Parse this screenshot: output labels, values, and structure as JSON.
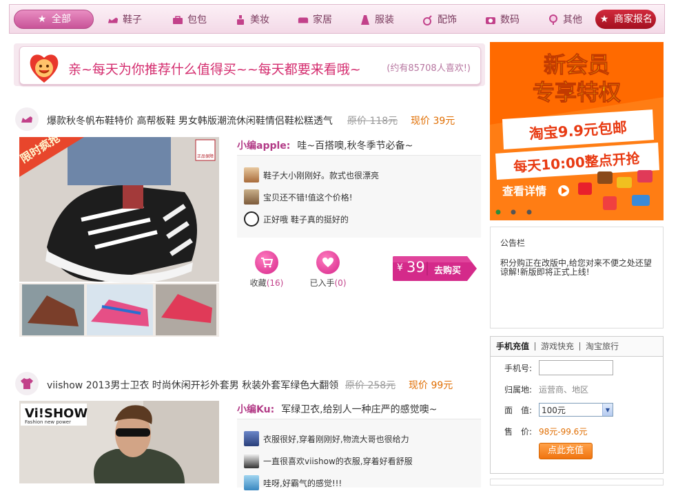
{
  "nav": {
    "items": [
      {
        "label": "全部",
        "icon": "star-icon"
      },
      {
        "label": "鞋子",
        "icon": "shoe-icon"
      },
      {
        "label": "包包",
        "icon": "bag-icon"
      },
      {
        "label": "美妆",
        "icon": "cosmetics-icon"
      },
      {
        "label": "家居",
        "icon": "home-icon"
      },
      {
        "label": "服装",
        "icon": "dress-icon"
      },
      {
        "label": "配饰",
        "icon": "ring-icon"
      },
      {
        "label": "数码",
        "icon": "camera-icon"
      },
      {
        "label": "其他",
        "icon": "lollipop-icon"
      },
      {
        "label": "商家报名",
        "icon": "star-icon"
      }
    ],
    "colors": {
      "accent": "#c85398",
      "merchant": "#b8182a"
    }
  },
  "banner": {
    "text": "亲~每天为你推荐什么值得买~~每天都要来看哦~",
    "count": "(约有85708人喜欢!)"
  },
  "items": [
    {
      "title": "爆款秋冬帆布鞋特价 高帮板鞋 男女韩版潮流休闲鞋情侣鞋松糕透气",
      "original_price": "原价 118元",
      "current_price": "现价 39元",
      "photo_badge": "限时疯抢",
      "photo_seal": "正品保障",
      "editor_name": "小编apple:",
      "editor_msg": "哇~百搭噢,秋冬季节必备~",
      "comments": [
        "鞋子大小刚刚好。款式也很漂亮",
        "宝贝还不错!值这个价格!",
        "正好哦 鞋子真的挺好的"
      ],
      "collect_label": "收藏",
      "collect_count": "(16)",
      "bought_label": "已入手",
      "bought_count": "(0)",
      "buy_price": "39",
      "buy_currency": "¥",
      "buy_label": "去购买"
    },
    {
      "title": "viishow 2013男士卫衣 时尚休闲开衫外套男 秋装外套军绿色大翻领",
      "original_price": "原价 258元",
      "current_price": "现价 99元",
      "photo_brand": "Vi!SHOW",
      "photo_tagline": "Fashion new power",
      "editor_name": "小编Ku:",
      "editor_msg": "军绿卫衣,给别人一种庄严的感觉噢~",
      "comments": [
        "衣服很好,穿着刚刚好,物流大哥也很给力",
        "一直很喜欢viishow的衣服,穿着好看舒服",
        "哇呀,好霸气的感觉!!!"
      ]
    }
  ],
  "sidebar": {
    "ad": {
      "headline1": "新会员",
      "headline2": "专享特权",
      "line1": "淘宝9.9元包邮",
      "line2": "每天10:00整点开抢",
      "cta": "查看详情"
    },
    "notice": {
      "title": "公告栏",
      "body": "积分购正在改版中,给您对来不便之处还望谅解!新版即将正式上线!"
    },
    "recharge": {
      "tabs": [
        "手机充值",
        "游戏快充",
        "淘宝旅行"
      ],
      "phone_label": "手机号:",
      "phone_value": "",
      "location_label": "归属地:",
      "location_value": "运营商、地区",
      "face_label": "面　值:",
      "face_value": "100元",
      "price_label": "售　价:",
      "price_value": "98元-99.6元",
      "button": "点此充值"
    }
  }
}
